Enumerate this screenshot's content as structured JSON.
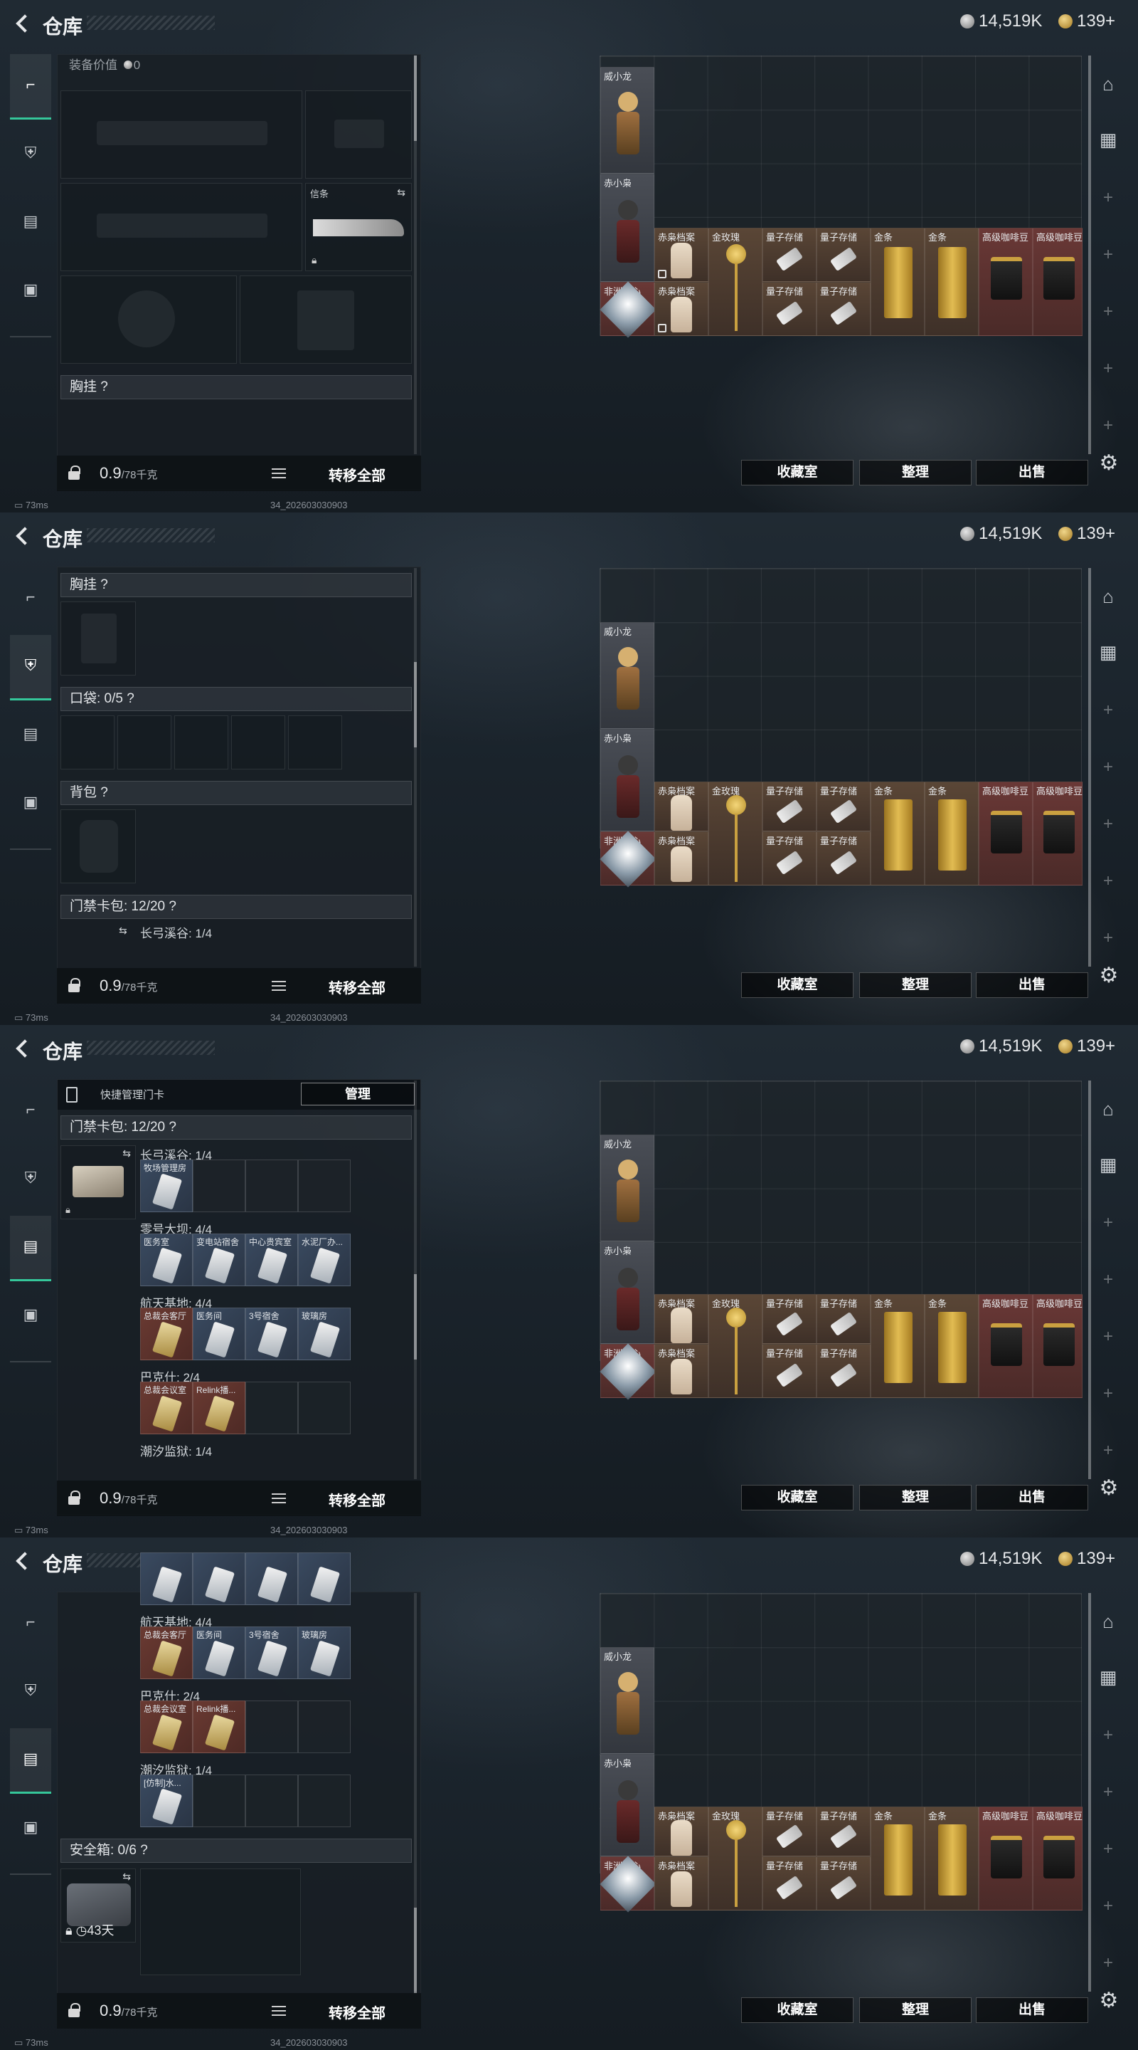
{
  "app": {
    "title": "仓库",
    "currency_silver": "14,519K",
    "currency_gold": "139+",
    "ping": "73ms",
    "build": "34_202603030903"
  },
  "tabs": [
    "weapon-tab",
    "armor-tab",
    "keycard-tab",
    "case-tab"
  ],
  "equipment": {
    "value_label": "装备价值",
    "value": "0",
    "knife_label": "信条",
    "chest_rig": "胸挂 ?",
    "pockets": "口袋: 0/5 ?",
    "backpack": "背包 ?",
    "keycard_bag": "门禁卡包: 12/20 ?",
    "safe_box": "安全箱: 0/6 ?",
    "safe_timer": "43天"
  },
  "bottom_bar": {
    "weight_value": "0.9",
    "weight_cap": "/78千克",
    "move_all": "转移全部"
  },
  "keycard": {
    "quick_manage": "快捷管理门卡",
    "manage_button": "管理",
    "groups": [
      {
        "name": "长弓溪谷: 1/4",
        "cards": [
          {
            "label": "牧场管理房",
            "color": "blue"
          }
        ]
      },
      {
        "name": "零号大坝: 4/4",
        "cards": [
          {
            "label": "医务室",
            "color": "blue"
          },
          {
            "label": "变电站宿舍",
            "color": "blue"
          },
          {
            "label": "中心贵宾室",
            "color": "blue"
          },
          {
            "label": "水泥厂办...",
            "color": "blue"
          }
        ]
      },
      {
        "name": "航天基地: 4/4",
        "cards": [
          {
            "label": "总裁会客厅",
            "color": "red"
          },
          {
            "label": "医务间",
            "color": "blue"
          },
          {
            "label": "3号宿舍",
            "color": "blue"
          },
          {
            "label": "玻璃房",
            "color": "blue"
          }
        ]
      },
      {
        "name": "巴克什: 2/4",
        "cards": [
          {
            "label": "总裁会议室",
            "color": "red"
          },
          {
            "label": "Relink播...",
            "color": "red"
          }
        ]
      },
      {
        "name": "潮汐监狱: 1/4",
        "cards": [
          {
            "label": "[仿制]水...",
            "color": "blue"
          }
        ]
      }
    ]
  },
  "grid_items": {
    "figure1": "威小龙",
    "figure2": "赤小枭",
    "diamond": "非洲之心",
    "archive": "赤枭档案",
    "rose": "金玫瑰",
    "usb": "量子存储",
    "gold": "金条",
    "coffee": "高级咖啡豆"
  },
  "buttons": {
    "collection": "收藏室",
    "organize": "整理",
    "sell": "出售"
  }
}
